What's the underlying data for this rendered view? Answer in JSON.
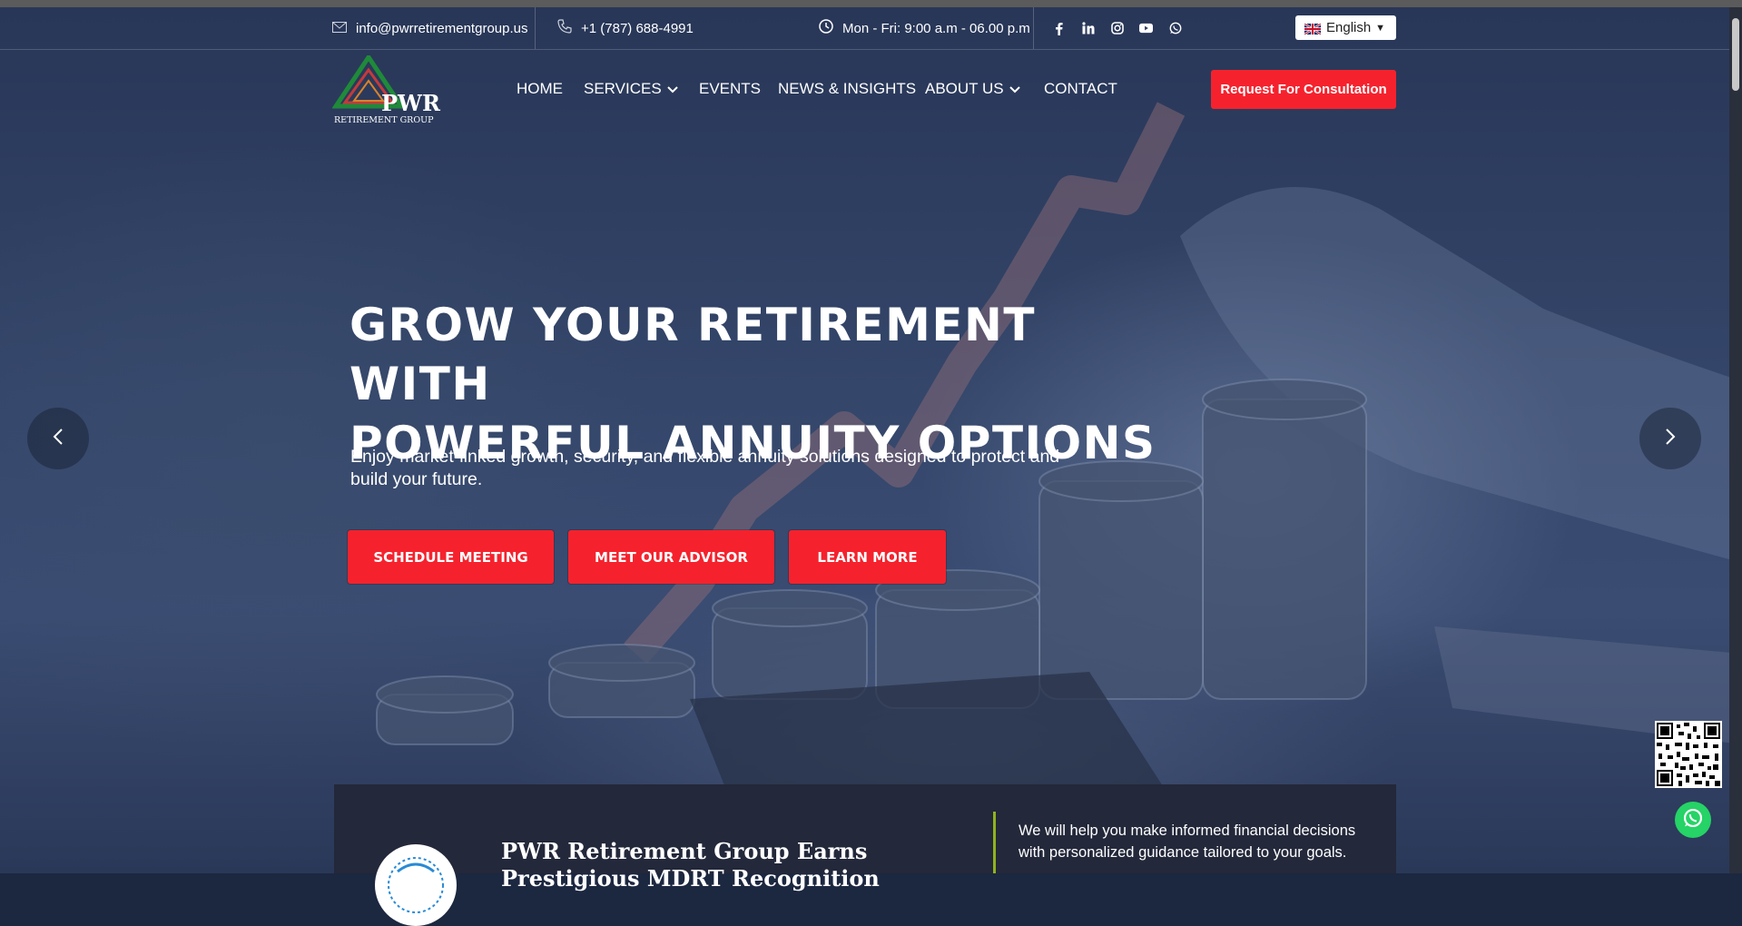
{
  "topbar": {
    "email": "info@pwrretirementgroup.us",
    "phone": "+1 (787) 688-4991",
    "hours": "Mon - Fri: 9:00 a.m - 06.00 p.m",
    "social_icons": [
      "facebook-icon",
      "linkedin-icon",
      "instagram-icon",
      "youtube-icon",
      "whatsapp-icon"
    ],
    "language": "English"
  },
  "logo": {
    "brand": "PWR",
    "tagline": "RETIREMENT GROUP"
  },
  "nav": {
    "items": [
      {
        "label": "HOME"
      },
      {
        "label": "SERVICES",
        "has_dropdown": true
      },
      {
        "label": "EVENTS"
      },
      {
        "label": "NEWS & INSIGHTS"
      },
      {
        "label": "ABOUT US",
        "has_dropdown": true
      },
      {
        "label": "CONTACT"
      }
    ],
    "cta": "Request For Consultation"
  },
  "hero": {
    "title_line1": "GROW YOUR RETIREMENT WITH",
    "title_line2": "POWERFUL ANNUITY OPTIONS",
    "subtitle": "Enjoy market-linked growth, security, and flexible annuity solutions designed to protect and build your future.",
    "buttons": [
      "SCHEDULE MEETING",
      "MEET OUR ADVISOR",
      "LEARN MORE"
    ]
  },
  "card": {
    "title": "PWR Retirement Group Earns Prestigious MDRT Recognition",
    "text": "We will help you make informed financial decisions with personalized guidance tailored to your goals."
  },
  "colors": {
    "accent": "#f5222d",
    "divider": "#8fb31f",
    "whatsapp": "#25d366"
  }
}
